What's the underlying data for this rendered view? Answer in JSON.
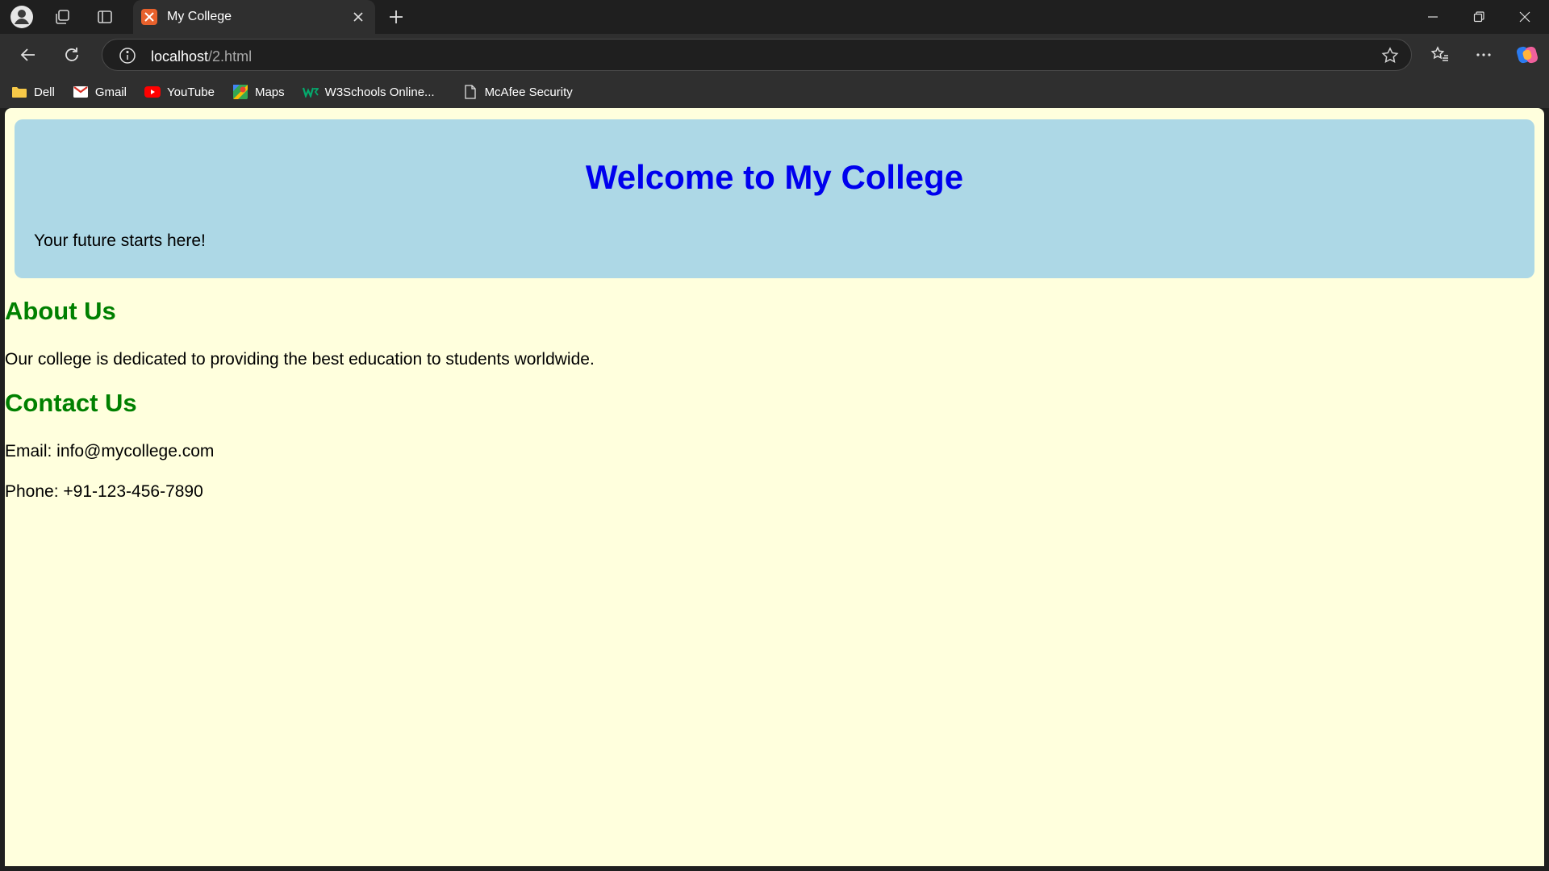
{
  "browser": {
    "tab_title": "My College",
    "url_host": "localhost",
    "url_path": "/2.html",
    "bookmarks": [
      {
        "label": "Dell",
        "icon": "folder-icon"
      },
      {
        "label": "Gmail",
        "icon": "gmail-icon"
      },
      {
        "label": "YouTube",
        "icon": "youtube-icon"
      },
      {
        "label": "Maps",
        "icon": "maps-icon"
      },
      {
        "label": "W3Schools Online...",
        "icon": "w3schools-icon"
      },
      {
        "label": "McAfee Security",
        "icon": "page-icon"
      }
    ]
  },
  "page": {
    "header_title": "Welcome to My College",
    "header_tagline": "Your future starts here!",
    "about_heading": "About Us",
    "about_text": "Our college is dedicated to providing the best education to students worldwide.",
    "contact_heading": "Contact Us",
    "contact_email": "Email: info@mycollege.com",
    "contact_phone": "Phone: +91-123-456-7890"
  },
  "colors": {
    "page_bg": "#ffffdd",
    "hero_bg": "#add8e6",
    "title": "#0000ee",
    "headings": "#008000"
  }
}
